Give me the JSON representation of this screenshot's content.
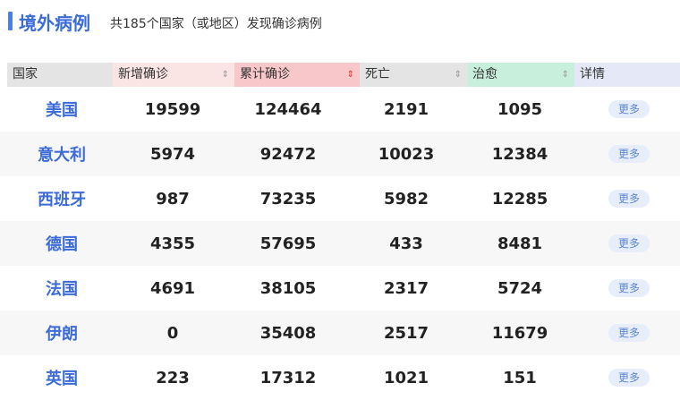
{
  "header": {
    "title": "境外病例",
    "subtitle": "共185个国家（或地区）发现确诊病例"
  },
  "table": {
    "columns": {
      "country": "国家",
      "new": "新增确诊",
      "total": "累计确诊",
      "dead": "死亡",
      "cured": "治愈",
      "detail": "详情"
    },
    "more_label": "更多",
    "rows": [
      {
        "country": "美国",
        "new": "19599",
        "total": "124464",
        "dead": "2191",
        "cured": "1095"
      },
      {
        "country": "意大利",
        "new": "5974",
        "total": "92472",
        "dead": "10023",
        "cured": "12384"
      },
      {
        "country": "西班牙",
        "new": "987",
        "total": "73235",
        "dead": "5982",
        "cured": "12285"
      },
      {
        "country": "德国",
        "new": "4355",
        "total": "57695",
        "dead": "433",
        "cured": "8481"
      },
      {
        "country": "法国",
        "new": "4691",
        "total": "38105",
        "dead": "2317",
        "cured": "5724"
      },
      {
        "country": "伊朗",
        "new": "0",
        "total": "35408",
        "dead": "2517",
        "cured": "11679"
      },
      {
        "country": "英国",
        "new": "223",
        "total": "17312",
        "dead": "1021",
        "cured": "151"
      }
    ]
  },
  "colors": {
    "accent": "#3b6bd8",
    "header_new": "#fbe4e4",
    "header_total": "#f7c7c9",
    "header_cured": "#c8eedc"
  }
}
